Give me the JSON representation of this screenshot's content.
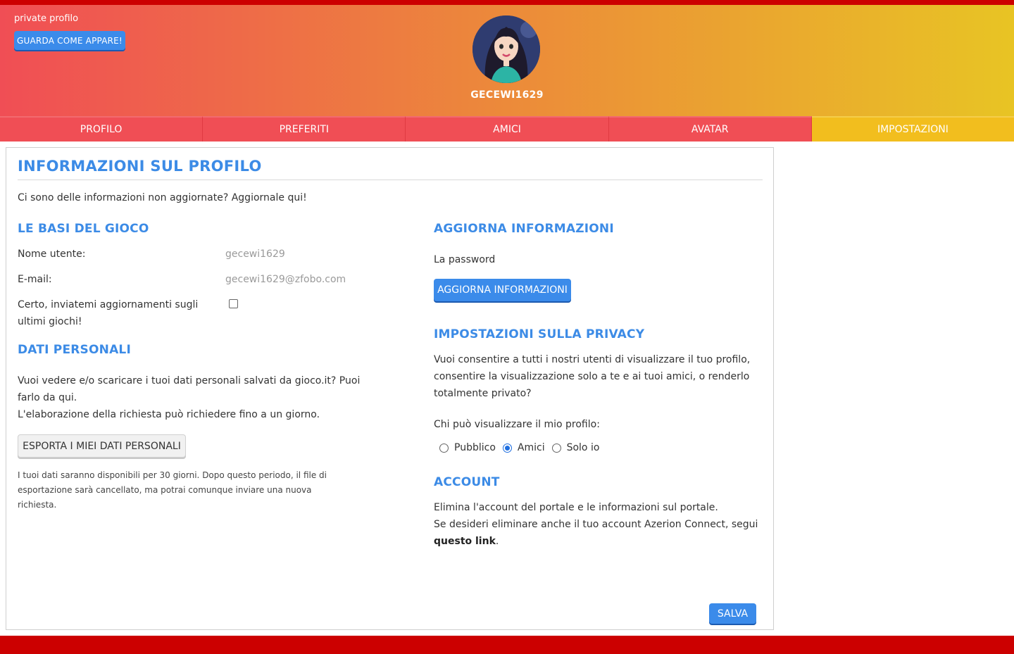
{
  "header": {
    "private_label": "private profilo",
    "preview_button": "GUARDA COME APPARE!",
    "username": "GECEWI1629"
  },
  "nav": {
    "tabs": [
      {
        "label": "PROFILO",
        "active": false
      },
      {
        "label": "PREFERITI",
        "active": false
      },
      {
        "label": "AMICI",
        "active": false
      },
      {
        "label": "AVATAR",
        "active": false
      },
      {
        "label": "IMPOSTAZIONI",
        "active": true
      }
    ]
  },
  "panel": {
    "title": "INFORMAZIONI SUL PROFILO",
    "intro": "Ci sono delle informazioni non aggiornate? Aggiornale qui!"
  },
  "basics": {
    "heading": "LE BASI DEL GIOCO",
    "username_label": "Nome utente:",
    "username_value": "gecewi1629",
    "email_label": "E-mail:",
    "email_value": "gecewi1629@zfobo.com",
    "newsletter_label_line1": "Certo, inviatemi aggiornamenti sugli",
    "newsletter_label_line2": "ultimi giochi!",
    "newsletter_checked": false
  },
  "personal_data": {
    "heading": "DATI PERSONALI",
    "line1": "Vuoi vedere e/o scaricare i tuoi dati personali salvati da gioco.it? Puoi",
    "line2": "farlo da qui.",
    "line3": "L'elaborazione della richiesta può richiedere fino a un giorno.",
    "export_button": "ESPORTA I MIEI DATI PERSONALI",
    "note": "I tuoi dati saranno disponibili per 30 giorni. Dopo questo periodo, il file di esportazione sarà cancellato, ma potrai comunque inviare una nuova richiesta."
  },
  "update": {
    "heading": "AGGIORNA INFORMAZIONI",
    "password_label": "La password",
    "button": "AGGIORNA INFORMAZIONI"
  },
  "privacy": {
    "heading": "IMPOSTAZIONI SULLA PRIVACY",
    "line1": "Vuoi consentire a tutti i nostri utenti di visualizzare il tuo profilo,",
    "line2": "consentire la visualizzazione solo a te e ai tuoi amici, o renderlo",
    "line3": "totalmente privato?",
    "who_label": "Chi può visualizzare il mio profilo:",
    "options": [
      {
        "label": "Pubblico",
        "checked": false
      },
      {
        "label": "Amici",
        "checked": true
      },
      {
        "label": "Solo io",
        "checked": false
      }
    ]
  },
  "account": {
    "heading": "ACCOUNT",
    "line1": "Elimina l'account del portale e le informazioni sul portale.",
    "line2": "Se desideri eliminare anche il tuo account Azerion Connect, segui",
    "link_text": "questo link",
    "after_link": "."
  },
  "save_button": "SALVA",
  "colors": {
    "accent_blue": "#3c8be6",
    "tab_red": "#f04e55",
    "tab_active": "#f2be1e",
    "gradient_start": "#f04e55",
    "gradient_end": "#e8c424"
  }
}
